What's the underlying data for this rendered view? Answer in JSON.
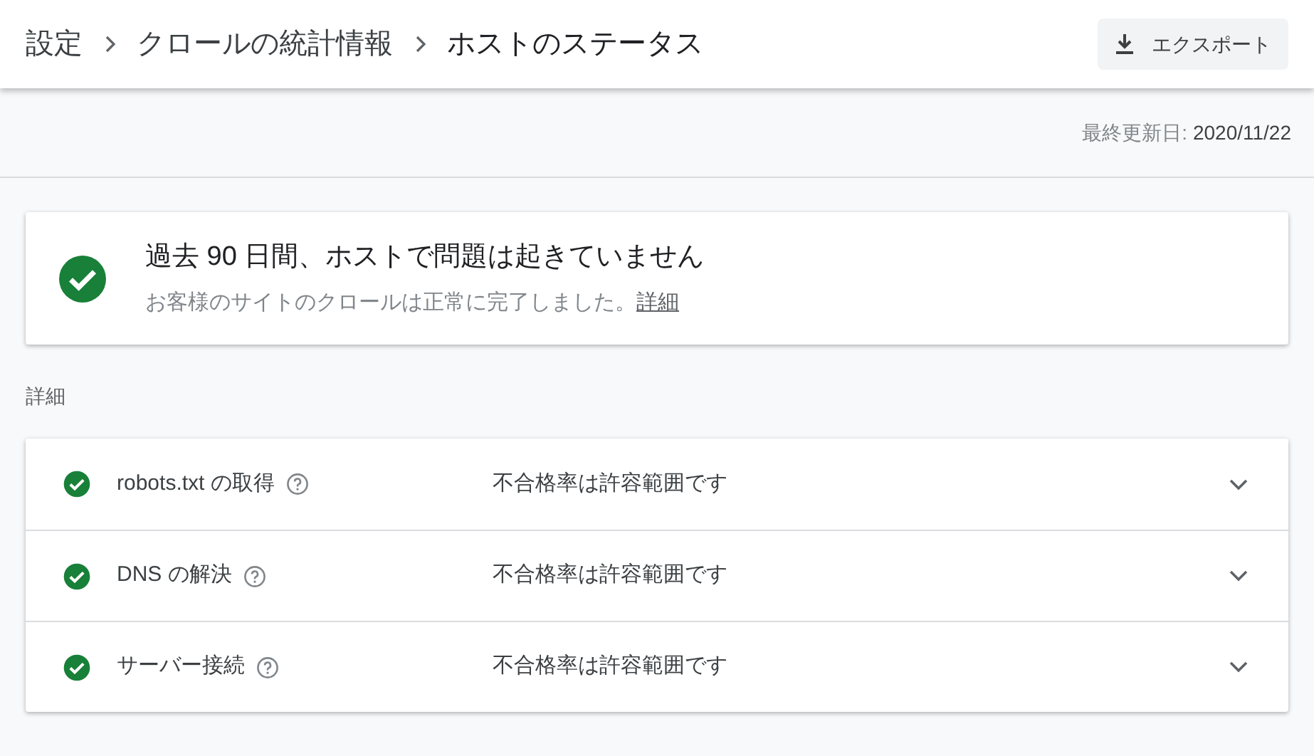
{
  "breadcrumbs": [
    {
      "label": "設定",
      "current": false
    },
    {
      "label": "クロールの統計情報",
      "current": false
    },
    {
      "label": "ホストのステータス",
      "current": true
    }
  ],
  "export_button": "エクスポート",
  "last_updated": {
    "label": "最終更新日:",
    "value": "2020/11/22"
  },
  "summary": {
    "passed": true,
    "title": "過去 90 日間、ホストで問題は起きていません",
    "text": "お客様のサイトのクロールは正常に完了しました。",
    "link": "詳細"
  },
  "details": {
    "heading": "詳細",
    "rows": [
      {
        "passed": true,
        "name": "robots.txt の取得",
        "result": "不合格率は許容範囲です",
        "expanded": false
      },
      {
        "passed": true,
        "name": "DNS の解決",
        "result": "不合格率は許容範囲です",
        "expanded": false
      },
      {
        "passed": true,
        "name": "サーバー接続",
        "result": "不合格率は許容範囲です",
        "expanded": false
      }
    ]
  }
}
